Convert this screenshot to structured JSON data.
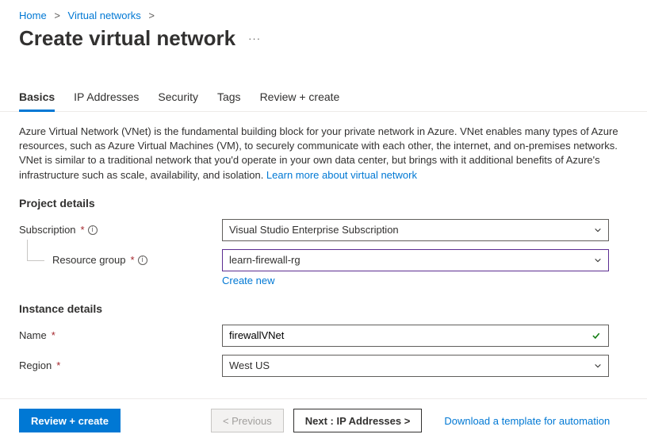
{
  "breadcrumb": {
    "home": "Home",
    "vnet": "Virtual networks"
  },
  "title": "Create virtual network",
  "tabs": {
    "basics": "Basics",
    "ip": "IP Addresses",
    "security": "Security",
    "tags": "Tags",
    "review": "Review + create"
  },
  "description": "Azure Virtual Network (VNet) is the fundamental building block for your private network in Azure. VNet enables many types of Azure resources, such as Azure Virtual Machines (VM), to securely communicate with each other, the internet, and on-premises networks. VNet is similar to a traditional network that you'd operate in your own data center, but brings with it additional benefits of Azure's infrastructure such as scale, availability, and isolation.  ",
  "learn_more": "Learn more about virtual network",
  "project_details_h": "Project details",
  "instance_details_h": "Instance details",
  "fields": {
    "subscription": {
      "label": "Subscription",
      "value": "Visual Studio Enterprise Subscription"
    },
    "resource_group": {
      "label": "Resource group",
      "value": "learn-firewall-rg",
      "create_new": "Create new"
    },
    "name": {
      "label": "Name",
      "value": "firewallVNet"
    },
    "region": {
      "label": "Region",
      "value": "West US"
    }
  },
  "footer": {
    "review": "Review + create",
    "previous": "< Previous",
    "next": "Next : IP Addresses >",
    "download": "Download a template for automation"
  },
  "icons": {
    "info": "i"
  }
}
